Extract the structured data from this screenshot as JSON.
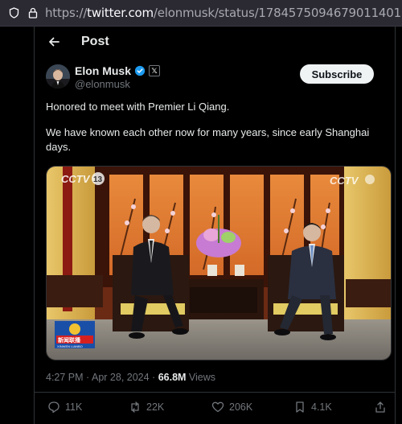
{
  "browser": {
    "url_scheme": "https://",
    "url_host": "twitter.com",
    "url_path": "/elonmusk/status/1784575094679011401"
  },
  "header": {
    "title": "Post"
  },
  "author": {
    "name": "Elon Musk",
    "handle": "@elonmusk",
    "subscribe_label": "Subscribe"
  },
  "tweet": {
    "paragraphs": [
      "Honored to meet with Premier Li Qiang.",
      "We have known each other now for many years, since early Shanghai days."
    ]
  },
  "media": {
    "watermark_channel": "CCTV 13",
    "watermark_corner": "CCTV 新闻",
    "news_logo_text": "新闻联播",
    "news_logo_sub": "XINWEN LIANBO"
  },
  "meta": {
    "time": "4:27 PM",
    "separator": " · ",
    "date": "Apr 28, 2024",
    "views_count": "66.8M",
    "views_label": "Views"
  },
  "actions": {
    "replies": "11K",
    "reposts": "22K",
    "likes": "206K",
    "bookmarks": "4.1K"
  },
  "colors": {
    "background": "#000000",
    "text": "#e7e9ea",
    "muted": "#71767b",
    "verified": "#1d9bf0",
    "urlbar": "#2b2a33"
  },
  "icons": {
    "shield": "shield-icon",
    "lock": "lock-icon",
    "back": "back-arrow-icon",
    "verified": "verified-badge-icon",
    "affiliate": "x-affiliate-icon",
    "reply": "reply-icon",
    "repost": "repost-icon",
    "like": "heart-icon",
    "bookmark": "bookmark-icon",
    "share": "share-icon"
  }
}
